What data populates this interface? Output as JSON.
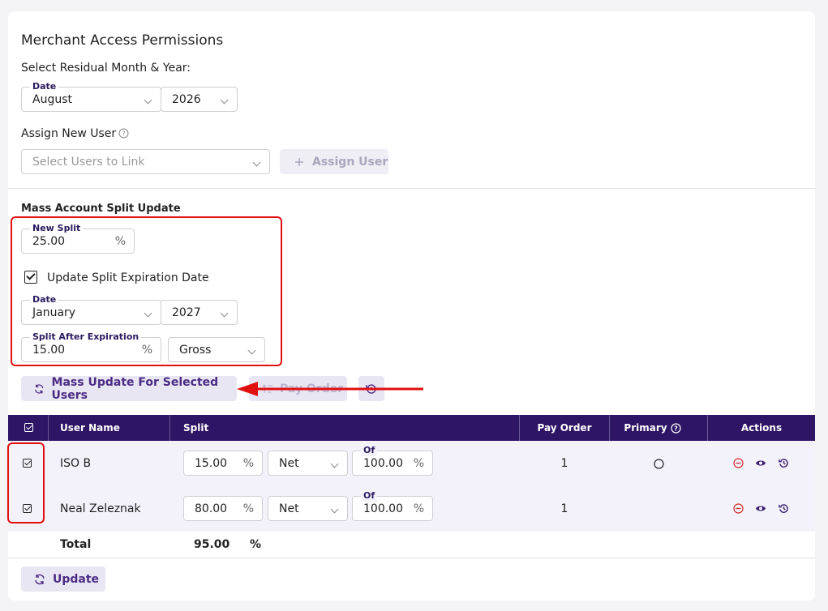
{
  "title": "Merchant Access Permissions",
  "residual": {
    "label": "Select Residual Month & Year:",
    "date_legend": "Date",
    "month": "August",
    "year": "2026"
  },
  "assign": {
    "label": "Assign New User",
    "placeholder": "Select Users to Link",
    "button": "Assign User"
  },
  "mass": {
    "heading": "Mass Account Split Update",
    "new_split_legend": "New Split",
    "new_split_value": "25.00",
    "percent": "%",
    "checkbox_label": "Update Split Expiration Date",
    "date_legend": "Date",
    "exp_month": "January",
    "exp_year": "2027",
    "after_legend": "Split After Expiration",
    "after_value": "15.00",
    "after_type": "Gross",
    "mass_button": "Mass Update For Selected Users",
    "pay_order_button": "Pay Order"
  },
  "table": {
    "headers": {
      "user_name": "User Name",
      "split": "Split",
      "pay_order": "Pay Order",
      "primary": "Primary",
      "actions": "Actions"
    },
    "rows": [
      {
        "name": "ISO B",
        "split": "15.00",
        "type": "Net",
        "of_label": "Of",
        "of": "100.00",
        "pay_order": "1"
      },
      {
        "name": "Neal Zeleznak",
        "split": "80.00",
        "type": "Net",
        "of_label": "Of",
        "of": "100.00",
        "pay_order": "1"
      }
    ],
    "total_label": "Total",
    "total_value": "95.00",
    "total_unit": "%"
  },
  "update_button": "Update",
  "colors": {
    "header_bg": "#2e1565",
    "accent": "#4a2c84",
    "annotation": "#e01010",
    "remove_icon": "#d62c2c"
  }
}
